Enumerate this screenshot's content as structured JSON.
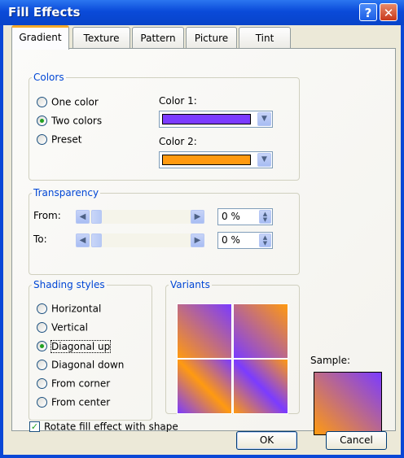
{
  "window": {
    "title": "Fill Effects",
    "help_label": "?",
    "close_label": "✕"
  },
  "tabs": [
    {
      "label": "Gradient",
      "active": true
    },
    {
      "label": "Texture",
      "active": false
    },
    {
      "label": "Pattern",
      "active": false
    },
    {
      "label": "Picture",
      "active": false
    },
    {
      "label": "Tint",
      "active": false
    }
  ],
  "colors": {
    "legend": "Colors",
    "options": [
      {
        "label": "One color",
        "checked": false
      },
      {
        "label": "Two colors",
        "checked": true
      },
      {
        "label": "Preset",
        "checked": false
      }
    ],
    "color1_label": "Color 1:",
    "color1_value": "#7b3bff",
    "color2_label": "Color 2:",
    "color2_value": "#ff9a10"
  },
  "transparency": {
    "legend": "Transparency",
    "from_label": "From:",
    "from_value": "0 %",
    "to_label": "To:",
    "to_value": "0 %"
  },
  "shading": {
    "legend": "Shading styles",
    "options": [
      {
        "label": "Horizontal",
        "checked": false
      },
      {
        "label": "Vertical",
        "checked": false
      },
      {
        "label": "Diagonal up",
        "checked": true
      },
      {
        "label": "Diagonal down",
        "checked": false
      },
      {
        "label": "From corner",
        "checked": false
      },
      {
        "label": "From center",
        "checked": false
      }
    ]
  },
  "variants": {
    "legend": "Variants"
  },
  "sample": {
    "label": "Sample:"
  },
  "rotate": {
    "label": "Rotate fill effect with shape",
    "checked": true
  },
  "buttons": {
    "ok": "OK",
    "cancel": "Cancel"
  }
}
